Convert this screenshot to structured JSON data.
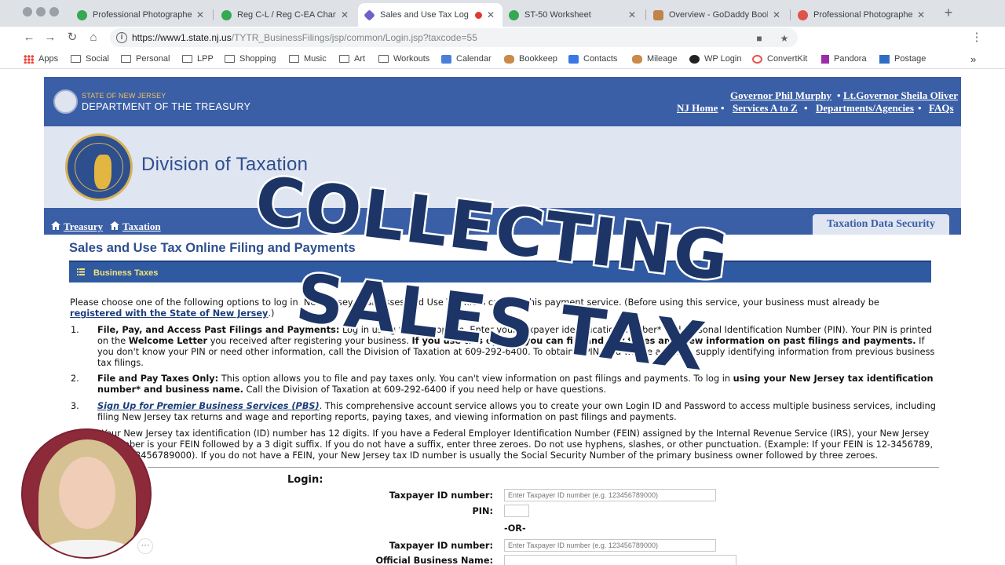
{
  "browser": {
    "tabs": [
      {
        "label": "Professional Photographer",
        "favicon_color": "#34a853",
        "active": false
      },
      {
        "label": "Reg C-L / Reg C-EA Chang",
        "favicon_color": "#34a853",
        "active": false
      },
      {
        "label": "Sales and Use Tax Log",
        "favicon_color": "#6b63c9",
        "active": true
      },
      {
        "label": "ST-50 Worksheet",
        "favicon_color": "#34a853",
        "active": false
      },
      {
        "label": "Overview - GoDaddy Book",
        "favicon_color": "#c0834a",
        "active": false
      },
      {
        "label": "Professional Photographer",
        "favicon_color": "#e0524a",
        "active": false
      }
    ],
    "new_tab": "+",
    "url_host": "https://www1.state.nj.us",
    "url_path": "/TYTR_BusinessFilings/jsp/common/Login.jsp?taxcode=55",
    "bookmarks": [
      {
        "label": "Apps",
        "icon": "apps-grid-icon"
      },
      {
        "label": "Social",
        "icon": "folder-icon"
      },
      {
        "label": "Personal",
        "icon": "folder-icon"
      },
      {
        "label": "LPP",
        "icon": "folder-icon"
      },
      {
        "label": "Shopping",
        "icon": "folder-icon"
      },
      {
        "label": "Music",
        "icon": "folder-icon"
      },
      {
        "label": "Art",
        "icon": "folder-icon"
      },
      {
        "label": "Workouts",
        "icon": "folder-icon"
      },
      {
        "label": "Calendar",
        "icon": "calendar-icon"
      },
      {
        "label": "Bookkeep",
        "icon": "hand-icon"
      },
      {
        "label": "Contacts",
        "icon": "contacts-icon"
      },
      {
        "label": "Mileage",
        "icon": "hand-icon"
      },
      {
        "label": "WP Login",
        "icon": "wordpress-icon"
      },
      {
        "label": "ConvertKit",
        "icon": "convertkit-icon"
      },
      {
        "label": "Pandora",
        "icon": "pandora-icon"
      },
      {
        "label": "Postage",
        "icon": "postage-icon"
      }
    ],
    "bookmarks_more": "»"
  },
  "header": {
    "state_line": "STATE OF NEW JERSEY",
    "department": "DEPARTMENT OF THE TREASURY",
    "governor": "Governor Phil Murphy",
    "bullet": "•",
    "lt_governor": "Lt.Governor Sheila Oliver",
    "links": [
      "NJ Home",
      "Services A to Z",
      "Departments/Agencies",
      "FAQs"
    ]
  },
  "banner": {
    "division": "Division of Taxation"
  },
  "nav": {
    "treasury": "Treasury",
    "taxation": "Taxation",
    "data_security_tab": "Taxation Data Security"
  },
  "main": {
    "title": "Sales and Use Tax Online Filing and Payments",
    "section_bar": "Business Taxes",
    "intro_start": "Please choose one of the following options to log in. New Jersey businesses and Use Tax filers can use this payment service. (Before using this service, your business must already be ",
    "intro_link": "registered with the State of New Jersey",
    "intro_end": ".)",
    "items": [
      {
        "num": "1.",
        "bold": "File, Pay, and Access Past Filings and Payments:",
        "text": " Log in using the first option. Enter your taxpayer identification number* and Personal Identification Number (PIN). Your PIN is printed on the ",
        "bold2": "Welcome Letter",
        "text2": " you received after registering your business. ",
        "bold3": "If you use this option, you can file and pay taxes and view information on past filings and payments.",
        "text3": " If you don't know your PIN or need other information, call the Division of Taxation at 609-292-6400. To obtain a PIN, you will be asked to supply identifying information from previous business tax filings."
      },
      {
        "num": "2.",
        "bold": "File and Pay Taxes Only:",
        "text": " This option allows you to file and pay taxes only. You can't view information on past filings and payments. To log in ",
        "bold2": "using your New Jersey tax identification number* and business name.",
        "text2": " Call the Division of Taxation at 609-292-6400 if you need help or have questions."
      },
      {
        "num": "3.",
        "link": "Sign Up for Premier Business Services (PBS)",
        "text": ". This comprehensive account service allows you to create your own Login ID and Password to access multiple business services, including filing New Jersey tax returns and wage and reporting reports, paying taxes, and viewing information on past filings and payments."
      }
    ],
    "footnote": "*Your New Jersey tax identification (ID) number has 12 digits. If you have a Federal Employer Identification Number (FEIN) assigned by the Internal Revenue Service (IRS), your New Jersey ID number is your FEIN followed by a 3 digit suffix. If you do not have a suffix, enter three zeroes. Do not use hyphens, slashes, or other punctuation. (Example: If your FEIN is 12-3456789, enter 123456789000). If you do not have a FEIN, your New Jersey tax ID number is usually the Social Security Number of the primary business owner followed by three zeroes."
  },
  "login": {
    "heading": "Login:",
    "taxpayer_label": "Taxpayer ID number:",
    "taxpayer_placeholder": "Enter Taxpayer ID number (e.g. 123456789000)",
    "pin_label": "PIN:",
    "or_text": "-OR-",
    "taxpayer2_label": "Taxpayer ID number:",
    "taxpayer2_placeholder": "Enter Taxpayer ID number (e.g. 123456789000)",
    "business_name_label": "Official Business Name:"
  },
  "overlay": {
    "line1": "COLLECTING",
    "line2": "SALES TAX",
    "color": "#1c3566",
    "more_button": "···"
  }
}
